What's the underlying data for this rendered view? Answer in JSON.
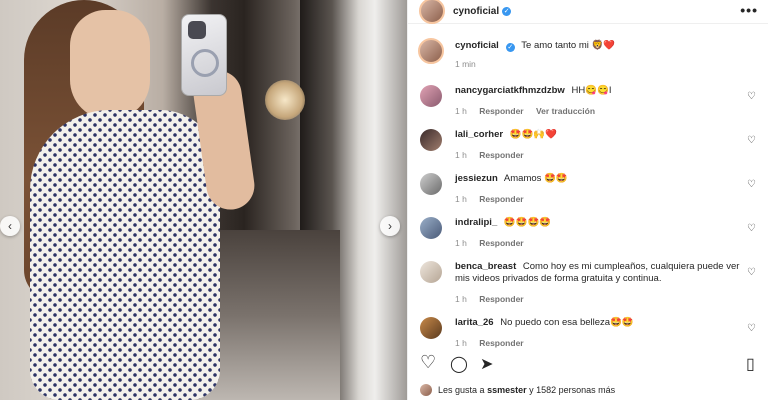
{
  "post": {
    "username": "cynoficial",
    "verified_mark": "✓"
  },
  "media": {
    "prev_icon": "‹",
    "next_icon": "›"
  },
  "caption": {
    "username": "cynoficial",
    "text": "Te amo tanto mi 🦁❤️",
    "time": "1 min"
  },
  "comments": [
    {
      "username": "nancygarciatkfhmzdzbw",
      "text": "HH😋😋I",
      "time": "1 h",
      "reply": "Responder",
      "translate": "Ver traducción"
    },
    {
      "username": "lali_corher",
      "text": "🤩🤩🙌❤️",
      "time": "1 h",
      "reply": "Responder"
    },
    {
      "username": "jessiezun",
      "text": "Amamos 🤩🤩",
      "time": "1 h",
      "reply": "Responder"
    },
    {
      "username": "indralipi_",
      "text": "🤩🤩🤩🤩",
      "time": "1 h",
      "reply": "Responder"
    },
    {
      "username": "benca_breast",
      "text": "Como hoy es mi cumpleaños, cualquiera puede ver mis videos privados de forma gratuita y continua.",
      "time": "1 h",
      "reply": "Responder"
    },
    {
      "username": "larita_26",
      "text": "No puedo con esa belleza🤩🤩",
      "time": "1 h",
      "reply": "Responder"
    }
  ],
  "actions": {
    "like_icon": "♡",
    "comment_icon": "◯",
    "share_icon": "➤",
    "save_icon": "▯"
  },
  "likes": {
    "prefix": "Les gusta a",
    "user": "ssmester",
    "suffix": "y 1582 personas más"
  },
  "icons": {
    "more": "•••",
    "heart": "♡"
  }
}
